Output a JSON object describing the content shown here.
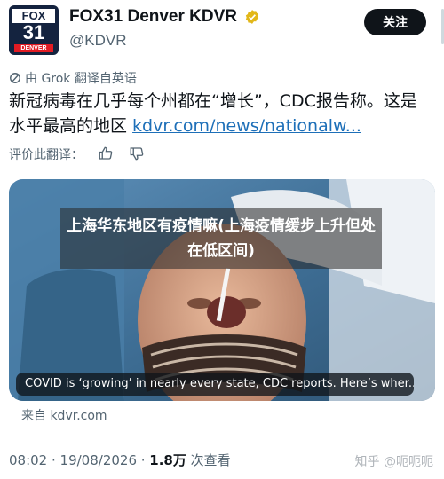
{
  "account": {
    "display_name": "FOX31 Denver KDVR",
    "handle": "@KDVR",
    "avatar_brand": "FOX",
    "avatar_number": "31",
    "avatar_city": "DENVER",
    "follow_label": "关注"
  },
  "translation": {
    "label": "由 Grok 翻译自英语"
  },
  "tweet": {
    "text": "新冠病毒在几乎每个州都在“增长”，CDC报告称。这是水平最高的地区 ",
    "link": "kdvr.com/news/nationalw..."
  },
  "rating": {
    "label": "评价此翻译："
  },
  "card": {
    "overlay_title": "上海华东地区有疫情嘛(上海疫情缓步上升但处在低区间)",
    "caption": "COVID is ‘growing’ in nearly every state, CDC reports. Here’s wher..."
  },
  "source": {
    "label": "来自 kdvr.com"
  },
  "meta": {
    "time": "08:02 · 19/08/2026 · ",
    "views": "1.8万",
    "views_label": " 次查看"
  },
  "watermark": "知乎 @呃呃呃",
  "colors": {
    "verified": "#e2b719",
    "link": "#1d6fb8",
    "follow_button": "#0f1419"
  }
}
